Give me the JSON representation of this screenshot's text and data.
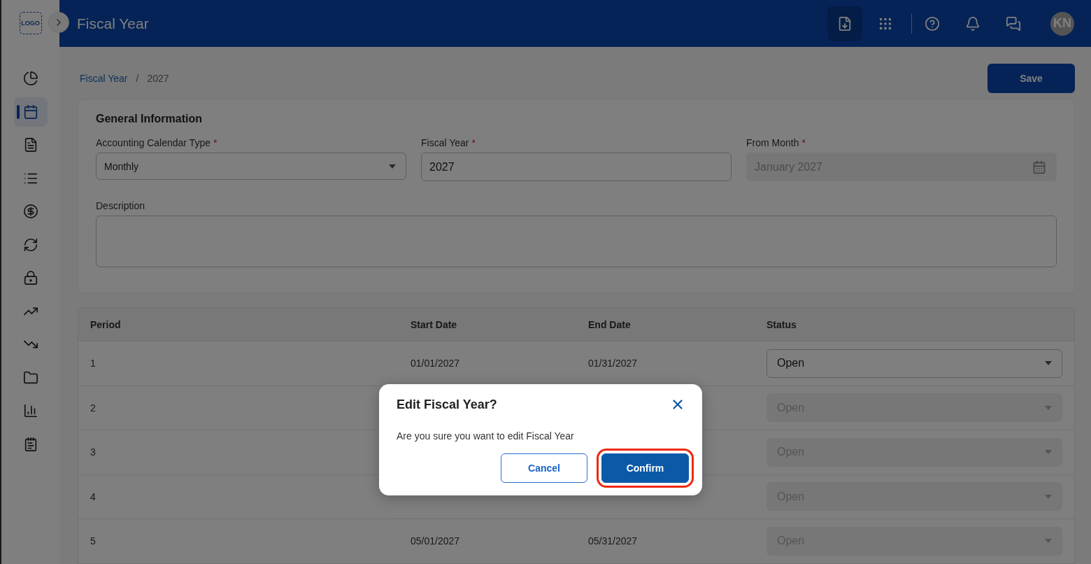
{
  "logo": {
    "text": "LOGO"
  },
  "header": {
    "title": "Fiscal Year",
    "avatar": "KN"
  },
  "sidebar": {
    "items": [
      {
        "selected": false
      },
      {
        "selected": true
      },
      {
        "selected": false
      },
      {
        "selected": false
      },
      {
        "selected": false
      },
      {
        "selected": false
      },
      {
        "selected": false
      },
      {
        "selected": false
      },
      {
        "selected": false
      },
      {
        "selected": false
      },
      {
        "selected": false
      },
      {
        "selected": false
      }
    ]
  },
  "breadcrumb": [
    {
      "label": "Fiscal Year",
      "kind": "link"
    },
    {
      "label": "/",
      "kind": "separator"
    },
    {
      "label": "2027",
      "kind": "current"
    }
  ],
  "save_button": "Save",
  "general_information": {
    "title": "General Information",
    "fields": [
      {
        "label": "Accounting Calendar Type",
        "required_mark": "*",
        "value": "Monthly",
        "kind": "select",
        "disabled": false
      },
      {
        "label": "Fiscal Year",
        "required_mark": "*",
        "value": "2027",
        "kind": "text",
        "disabled": false
      },
      {
        "label": "From Month",
        "required_mark": "*",
        "value": "January 2027",
        "kind": "date",
        "disabled": true
      }
    ],
    "description": {
      "label": "Description"
    }
  },
  "table": {
    "columns": [
      "Period",
      "Start Date",
      "End Date",
      "Status"
    ],
    "rows": [
      {
        "period": "1",
        "start_date": "01/01/2027",
        "end_date": "01/31/2027",
        "status": "Open",
        "disabled": false
      },
      {
        "period": "2",
        "status": "Open",
        "disabled": true
      },
      {
        "period": "3",
        "status": "Open",
        "disabled": true
      },
      {
        "period": "4",
        "status": "Open",
        "disabled": true
      },
      {
        "period": "5",
        "start_date": "05/01/2027",
        "end_date": "05/31/2027",
        "status": "Open",
        "disabled": true
      }
    ]
  },
  "dialog": {
    "title": "Edit Fiscal Year?",
    "message": "Are you sure you want to edit Fiscal Year",
    "buttons": [
      {
        "label": "Cancel",
        "kind": "secondary",
        "highlighted": false
      },
      {
        "label": "Confirm",
        "kind": "primary",
        "highlighted": true
      }
    ]
  }
}
